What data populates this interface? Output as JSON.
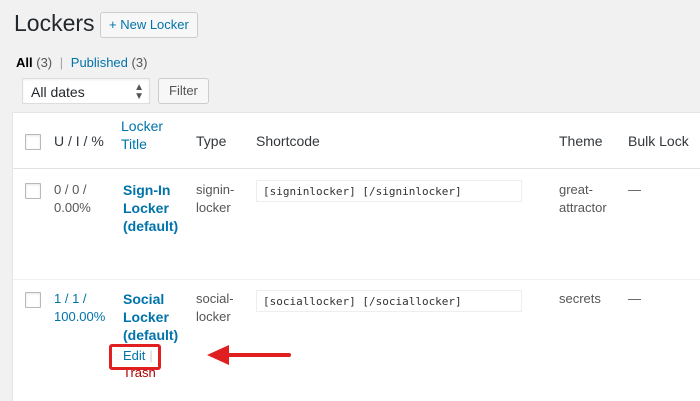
{
  "header": {
    "title": "Lockers",
    "add_new_label": "+ New Locker"
  },
  "views": {
    "all_label": "All",
    "all_count": "(3)",
    "separator": "|",
    "published_label": "Published",
    "published_count": "(3)"
  },
  "filters": {
    "date_value": "All dates",
    "filter_label": "Filter"
  },
  "table": {
    "columns": {
      "stats": "U / I / %",
      "title_line1": "Locker",
      "title_line2": "Title",
      "type": "Type",
      "shortcode": "Shortcode",
      "theme": "Theme",
      "bulk_lock": "Bulk Lock"
    },
    "rows": [
      {
        "stats_line1": "0 / 0 /",
        "stats_line2": "0.00%",
        "title_line1": "Sign-In",
        "title_line2": "Locker",
        "title_line3": "(default)",
        "type_line1": "signin-",
        "type_line2": "locker",
        "shortcode": "[signinlocker] [/signinlocker]",
        "theme_line1": "great-",
        "theme_line2": "attractor",
        "bulk_lock": "—"
      },
      {
        "stats_line1": "1 / 1 /",
        "stats_line2": "100.00%",
        "title_line1": "Social",
        "title_line2": "Locker",
        "title_line3": "(default)",
        "type_line1": "social-",
        "type_line2": "locker",
        "shortcode": "[sociallocker] [/sociallocker]",
        "theme_line1": "secrets",
        "bulk_lock": "—",
        "actions": {
          "edit": "Edit",
          "pipe": "|",
          "trash": "Trash"
        }
      }
    ]
  },
  "colors": {
    "accent": "#0073aa",
    "highlight": "#e02020",
    "trash": "#a00000"
  }
}
